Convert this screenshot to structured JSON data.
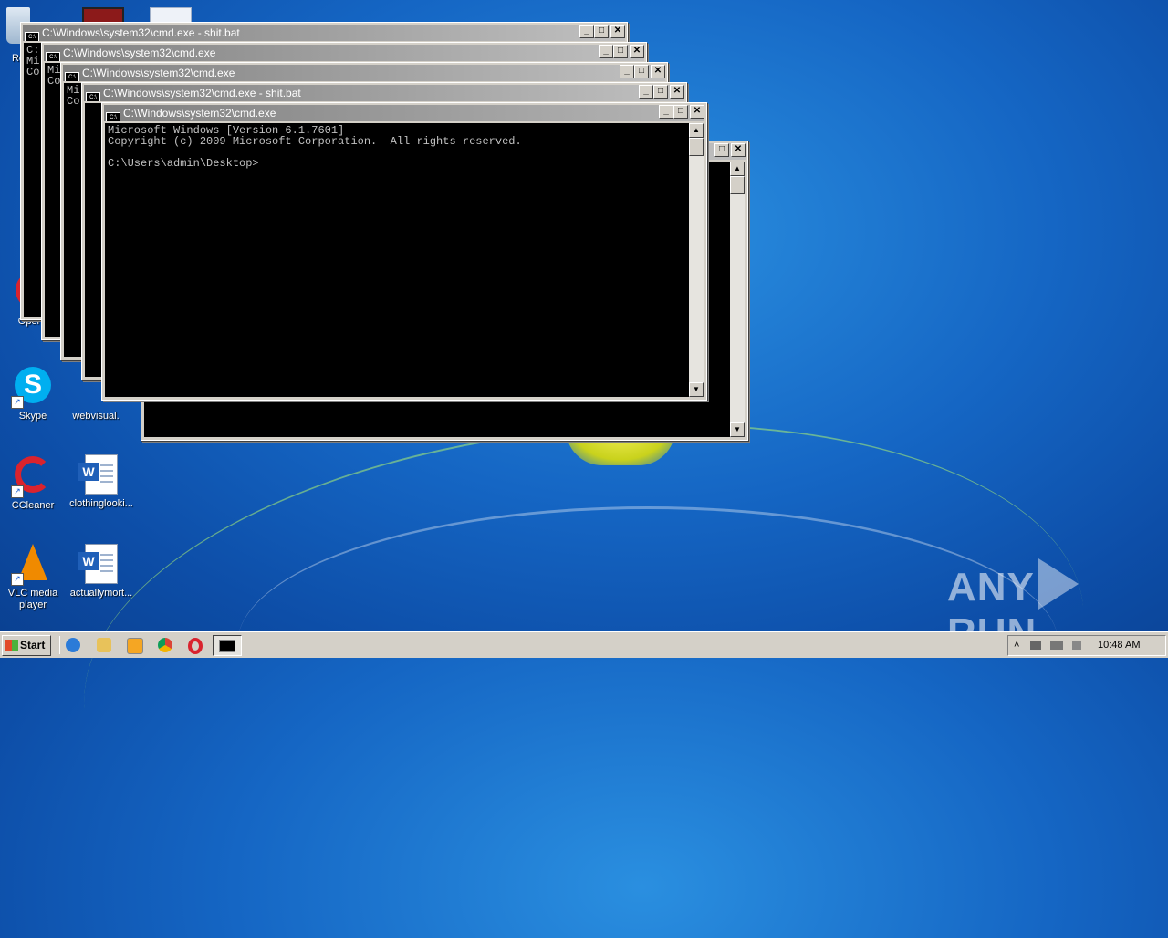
{
  "desktop": {
    "icons": [
      {
        "label": "Re",
        "name": "recycle-bin"
      },
      {
        "label": "Skype",
        "name": "skype"
      },
      {
        "label": "webvisual.",
        "name": "webvisual"
      },
      {
        "label": "CCleaner",
        "name": "ccleaner"
      },
      {
        "label": "clothinglooki...",
        "name": "clothinglooking-doc"
      },
      {
        "label": "VLC media player",
        "name": "vlc"
      },
      {
        "label": "actuallymort...",
        "name": "actuallymort-doc"
      },
      {
        "label": "Oper",
        "name": "opera"
      }
    ]
  },
  "windows": [
    {
      "title": "C:\\Windows\\system32\\cmd.exe - shit.bat",
      "lines": [
        "C:",
        "Mi",
        "Co",
        "",
        "C:",
        "",
        "C:",
        "",
        "C:",
        "",
        "C:",
        "Mi",
        "Co",
        "",
        "C:"
      ]
    },
    {
      "title": "C:\\Windows\\system32\\cmd.exe",
      "lines": [
        "Mi",
        "Co",
        "",
        "C:"
      ]
    },
    {
      "title": "C:\\Windows\\system32\\cmd.exe",
      "lines": [
        "Mi",
        "Co",
        "",
        "C:"
      ]
    },
    {
      "title": "C:\\Windows\\system32\\cmd.exe - shit.bat",
      "lines": [
        "C:",
        "",
        "C:",
        "",
        "C:",
        "",
        "C:",
        "Mi"
      ]
    },
    {
      "title": "C:\\Windows\\system32\\cmd.exe",
      "lines": [
        "Microsoft Windows [Version 6.1.7601]",
        "Copyright (c) 2009 Microsoft Corporation.  All rights reserved.",
        "",
        "C:\\Users\\admin\\Desktop>"
      ]
    }
  ],
  "window_buttons": {
    "minimize": "_",
    "maximize": "□",
    "close": "✕"
  },
  "taskbar": {
    "start_label": "Start",
    "clock": "10:48 AM",
    "tray_arrow": "˄"
  },
  "watermark": {
    "left": "ANY",
    "right": "RUN"
  }
}
